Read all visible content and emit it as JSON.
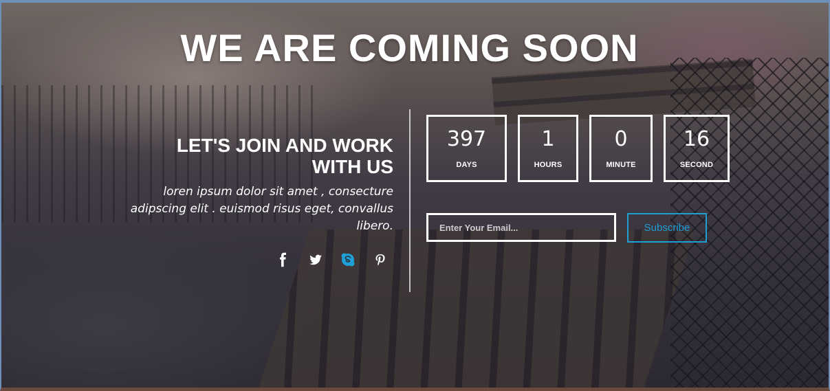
{
  "page": {
    "headline": "WE ARE COMING SOON",
    "subheadline_line1": "LET'S JOIN AND WORK",
    "subheadline_line2": "WITH US",
    "description_line1": "loren ipsum dolor sit amet , consecture",
    "description_line2": "adipscing elit . euismod risus eget, convallus",
    "description_line3": "libero."
  },
  "social": {
    "icons": [
      {
        "name": "facebook-icon",
        "glyph": "f"
      },
      {
        "name": "twitter-icon",
        "glyph": "🐦"
      },
      {
        "name": "skype-icon",
        "glyph": "S"
      },
      {
        "name": "pinterest-icon",
        "glyph": "P"
      }
    ],
    "active_color": "#1e9fd6"
  },
  "countdown": {
    "days": {
      "value": "397",
      "label": "DAYS"
    },
    "hours": {
      "value": "1",
      "label": "HOURS"
    },
    "minutes": {
      "value": "0",
      "label": "MINUTE"
    },
    "seconds": {
      "value": "16",
      "label": "SECOND"
    }
  },
  "subscribe": {
    "placeholder": "Enter Your Email...",
    "button_label": "Subscribe",
    "accent_color": "#1e9fd6"
  }
}
